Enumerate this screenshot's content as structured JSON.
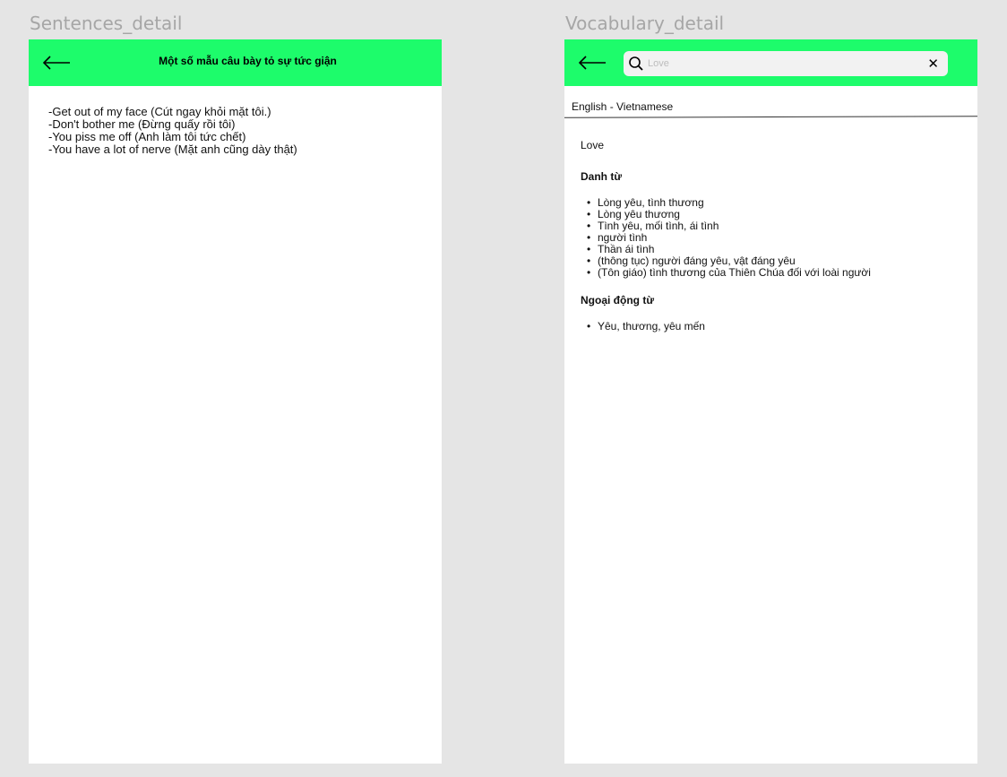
{
  "left_frame": {
    "label": "Sentences_detail",
    "header_title": "Một số mẫu câu bày tỏ sự tức giận",
    "sentences": [
      "-Get out of my face (Cút ngay khỏi mặt tôi.)",
      "-Don't bother me (Đừng quấy rồi tôi)",
      "-You piss me off (Anh làm tôi tức chết)",
      "-You have a lot of nerve (Mặt anh cũng dày thật)"
    ]
  },
  "right_frame": {
    "label": "Vocabulary_detail",
    "search": {
      "placeholder": "Love",
      "value": ""
    },
    "clear_glyph": "✕",
    "language_tab": "English - Vietnamese",
    "headword": "Love",
    "noun_section": {
      "title": "Danh từ",
      "items": [
        "Lòng yêu, tình thương",
        "Lòng yêu thương",
        "Tình yêu, mối tình, ái tình",
        "người tình",
        "Thần ái tình",
        "(thông tục) người đáng yêu, vật đáng yêu",
        "(Tôn giáo) tình thương của Thiên Chúa đối với loài người"
      ]
    },
    "verb_section": {
      "title": "Ngoại động từ",
      "items": [
        "Yêu, thương, yêu mến"
      ]
    }
  },
  "colors": {
    "appbar": "#1dfc6b",
    "canvas": "#e5e5e5",
    "frame": "#ffffff",
    "label": "#a6a6a6"
  },
  "icons": {
    "back": "arrow-left-icon",
    "search": "search-icon",
    "clear": "close-icon"
  }
}
